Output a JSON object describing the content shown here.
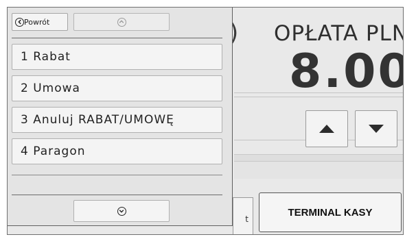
{
  "background": {
    "paren": ")",
    "fee_label": "OPŁATA PLN",
    "fee_value": "8.00",
    "small_button_label": "t",
    "terminal_button": "TERMINAL KASY"
  },
  "popup": {
    "back_label": "Powrót",
    "items": [
      {
        "label": "1 Rabat"
      },
      {
        "label": "2 Umowa"
      },
      {
        "label": "3 Anuluj RABAT/UMOWĘ"
      },
      {
        "label": "4 Paragon"
      }
    ]
  }
}
